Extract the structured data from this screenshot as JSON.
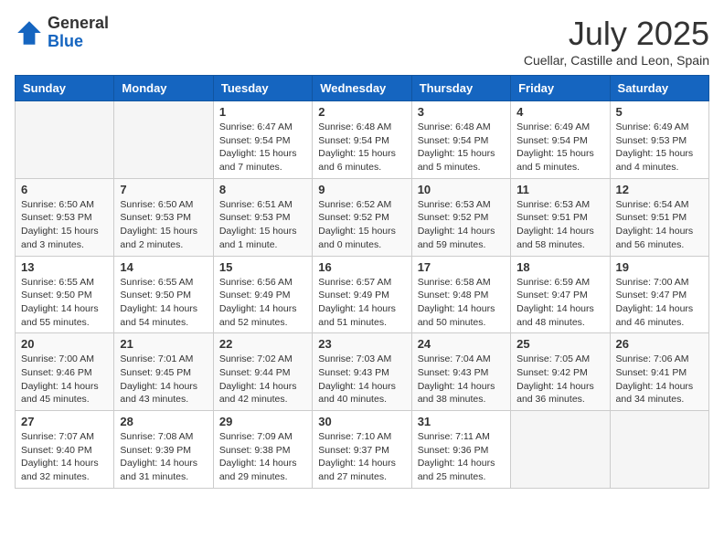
{
  "header": {
    "logo_general": "General",
    "logo_blue": "Blue",
    "month": "July 2025",
    "location": "Cuellar, Castille and Leon, Spain"
  },
  "weekdays": [
    "Sunday",
    "Monday",
    "Tuesday",
    "Wednesday",
    "Thursday",
    "Friday",
    "Saturday"
  ],
  "weeks": [
    [
      {
        "day": "",
        "content": ""
      },
      {
        "day": "",
        "content": ""
      },
      {
        "day": "1",
        "content": "Sunrise: 6:47 AM\nSunset: 9:54 PM\nDaylight: 15 hours and 7 minutes."
      },
      {
        "day": "2",
        "content": "Sunrise: 6:48 AM\nSunset: 9:54 PM\nDaylight: 15 hours and 6 minutes."
      },
      {
        "day": "3",
        "content": "Sunrise: 6:48 AM\nSunset: 9:54 PM\nDaylight: 15 hours and 5 minutes."
      },
      {
        "day": "4",
        "content": "Sunrise: 6:49 AM\nSunset: 9:54 PM\nDaylight: 15 hours and 5 minutes."
      },
      {
        "day": "5",
        "content": "Sunrise: 6:49 AM\nSunset: 9:53 PM\nDaylight: 15 hours and 4 minutes."
      }
    ],
    [
      {
        "day": "6",
        "content": "Sunrise: 6:50 AM\nSunset: 9:53 PM\nDaylight: 15 hours and 3 minutes."
      },
      {
        "day": "7",
        "content": "Sunrise: 6:50 AM\nSunset: 9:53 PM\nDaylight: 15 hours and 2 minutes."
      },
      {
        "day": "8",
        "content": "Sunrise: 6:51 AM\nSunset: 9:53 PM\nDaylight: 15 hours and 1 minute."
      },
      {
        "day": "9",
        "content": "Sunrise: 6:52 AM\nSunset: 9:52 PM\nDaylight: 15 hours and 0 minutes."
      },
      {
        "day": "10",
        "content": "Sunrise: 6:53 AM\nSunset: 9:52 PM\nDaylight: 14 hours and 59 minutes."
      },
      {
        "day": "11",
        "content": "Sunrise: 6:53 AM\nSunset: 9:51 PM\nDaylight: 14 hours and 58 minutes."
      },
      {
        "day": "12",
        "content": "Sunrise: 6:54 AM\nSunset: 9:51 PM\nDaylight: 14 hours and 56 minutes."
      }
    ],
    [
      {
        "day": "13",
        "content": "Sunrise: 6:55 AM\nSunset: 9:50 PM\nDaylight: 14 hours and 55 minutes."
      },
      {
        "day": "14",
        "content": "Sunrise: 6:55 AM\nSunset: 9:50 PM\nDaylight: 14 hours and 54 minutes."
      },
      {
        "day": "15",
        "content": "Sunrise: 6:56 AM\nSunset: 9:49 PM\nDaylight: 14 hours and 52 minutes."
      },
      {
        "day": "16",
        "content": "Sunrise: 6:57 AM\nSunset: 9:49 PM\nDaylight: 14 hours and 51 minutes."
      },
      {
        "day": "17",
        "content": "Sunrise: 6:58 AM\nSunset: 9:48 PM\nDaylight: 14 hours and 50 minutes."
      },
      {
        "day": "18",
        "content": "Sunrise: 6:59 AM\nSunset: 9:47 PM\nDaylight: 14 hours and 48 minutes."
      },
      {
        "day": "19",
        "content": "Sunrise: 7:00 AM\nSunset: 9:47 PM\nDaylight: 14 hours and 46 minutes."
      }
    ],
    [
      {
        "day": "20",
        "content": "Sunrise: 7:00 AM\nSunset: 9:46 PM\nDaylight: 14 hours and 45 minutes."
      },
      {
        "day": "21",
        "content": "Sunrise: 7:01 AM\nSunset: 9:45 PM\nDaylight: 14 hours and 43 minutes."
      },
      {
        "day": "22",
        "content": "Sunrise: 7:02 AM\nSunset: 9:44 PM\nDaylight: 14 hours and 42 minutes."
      },
      {
        "day": "23",
        "content": "Sunrise: 7:03 AM\nSunset: 9:43 PM\nDaylight: 14 hours and 40 minutes."
      },
      {
        "day": "24",
        "content": "Sunrise: 7:04 AM\nSunset: 9:43 PM\nDaylight: 14 hours and 38 minutes."
      },
      {
        "day": "25",
        "content": "Sunrise: 7:05 AM\nSunset: 9:42 PM\nDaylight: 14 hours and 36 minutes."
      },
      {
        "day": "26",
        "content": "Sunrise: 7:06 AM\nSunset: 9:41 PM\nDaylight: 14 hours and 34 minutes."
      }
    ],
    [
      {
        "day": "27",
        "content": "Sunrise: 7:07 AM\nSunset: 9:40 PM\nDaylight: 14 hours and 32 minutes."
      },
      {
        "day": "28",
        "content": "Sunrise: 7:08 AM\nSunset: 9:39 PM\nDaylight: 14 hours and 31 minutes."
      },
      {
        "day": "29",
        "content": "Sunrise: 7:09 AM\nSunset: 9:38 PM\nDaylight: 14 hours and 29 minutes."
      },
      {
        "day": "30",
        "content": "Sunrise: 7:10 AM\nSunset: 9:37 PM\nDaylight: 14 hours and 27 minutes."
      },
      {
        "day": "31",
        "content": "Sunrise: 7:11 AM\nSunset: 9:36 PM\nDaylight: 14 hours and 25 minutes."
      },
      {
        "day": "",
        "content": ""
      },
      {
        "day": "",
        "content": ""
      }
    ]
  ]
}
